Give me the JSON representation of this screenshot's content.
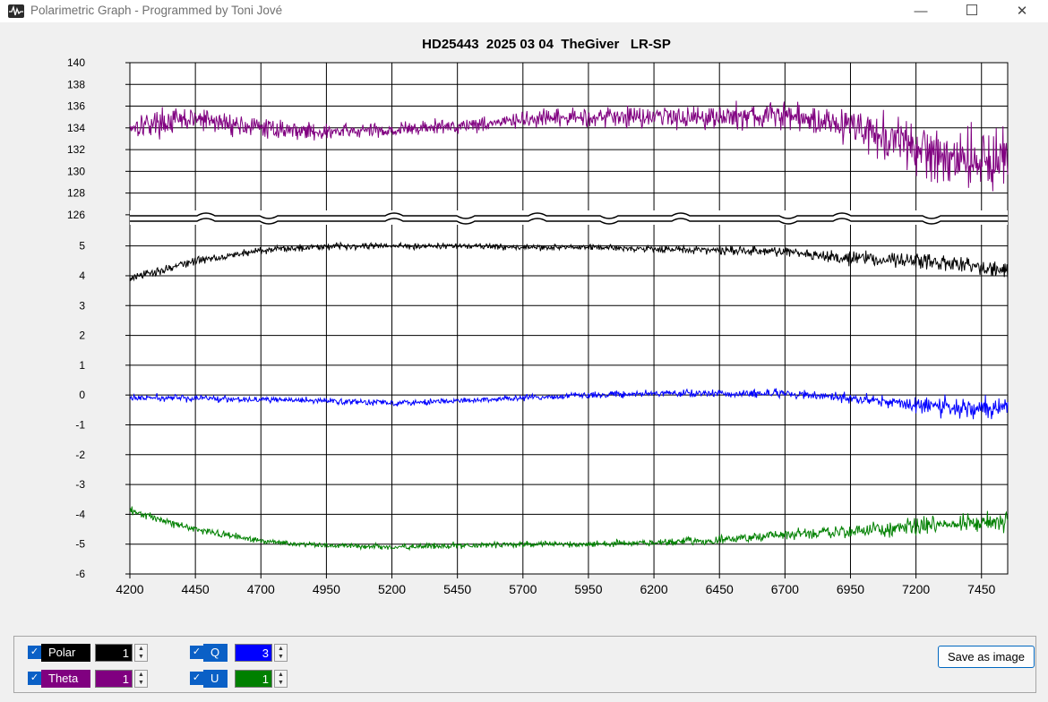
{
  "window": {
    "title": "Polarimetric Graph - Programmed by Toni Jové",
    "minimize_glyph": "—",
    "close_glyph": "✕"
  },
  "colors": {
    "polar": "#000000",
    "theta": "#800080",
    "q": "#0000ff",
    "u": "#008000"
  },
  "chart_data": {
    "type": "line",
    "title": "HD25443  2025 03 04  TheGiver   LR-SP",
    "xlim": [
      4200,
      7550
    ],
    "x_ticks": [
      "4200",
      "4450",
      "4700",
      "4950",
      "5200",
      "5450",
      "5700",
      "5950",
      "6200",
      "6450",
      "6700",
      "6950",
      "7200",
      "7450"
    ],
    "upper_panel": {
      "ylim": [
        125,
        140
      ],
      "y_ticks": [
        {
          "v": 140,
          "label": "140"
        },
        {
          "v": 138,
          "label": "138"
        },
        {
          "v": 136,
          "label": "136"
        },
        {
          "v": 134,
          "label": "134"
        },
        {
          "v": 132,
          "label": "132"
        },
        {
          "v": 130,
          "label": "130"
        },
        {
          "v": 128,
          "label": "128"
        },
        {
          "v": 126,
          "label": "126"
        }
      ]
    },
    "lower_panel": {
      "ylim": [
        -6,
        5.5
      ],
      "y_ticks": [
        {
          "v": 5,
          "label": "5"
        },
        {
          "v": 4,
          "label": "4"
        },
        {
          "v": 3,
          "label": "3"
        },
        {
          "v": 2,
          "label": "2"
        },
        {
          "v": 1,
          "label": "1"
        },
        {
          "v": 0,
          "label": "0"
        },
        {
          "v": -1,
          "label": "-1"
        },
        {
          "v": -2,
          "label": "-2"
        },
        {
          "v": -3,
          "label": "-3"
        },
        {
          "v": -4,
          "label": "-4"
        },
        {
          "v": -5,
          "label": "-5"
        },
        {
          "v": -6,
          "label": "-6"
        }
      ]
    },
    "series": [
      {
        "name": "Theta",
        "panel": "upper",
        "color": "#800080",
        "x": [
          4200,
          4450,
          4700,
          4950,
          5200,
          5450,
          5700,
          5950,
          6200,
          6450,
          6700,
          6950,
          7200,
          7450,
          7550
        ],
        "y": [
          134.2,
          134.8,
          134.0,
          133.6,
          133.8,
          134.2,
          134.7,
          135.0,
          135.1,
          135.0,
          135.1,
          134.3,
          132.0,
          131.0,
          131.5
        ],
        "noise": [
          0.8,
          0.8,
          0.6,
          0.5,
          0.5,
          0.5,
          0.5,
          0.6,
          0.7,
          0.8,
          0.9,
          1.1,
          1.8,
          2.0,
          2.0
        ]
      },
      {
        "name": "Polar",
        "panel": "lower",
        "color": "#000000",
        "x": [
          4200,
          4450,
          4700,
          4950,
          5200,
          5450,
          5700,
          5950,
          6200,
          6450,
          6700,
          6950,
          7200,
          7450,
          7550
        ],
        "y": [
          3.9,
          4.5,
          4.85,
          5.0,
          5.0,
          5.0,
          4.95,
          4.95,
          4.9,
          4.85,
          4.8,
          4.6,
          4.5,
          4.3,
          4.2
        ],
        "noise": [
          0.1,
          0.1,
          0.08,
          0.08,
          0.07,
          0.07,
          0.07,
          0.07,
          0.08,
          0.1,
          0.12,
          0.15,
          0.18,
          0.2,
          0.2
        ]
      },
      {
        "name": "Q",
        "panel": "lower",
        "color": "#0000ff",
        "x": [
          4200,
          4450,
          4700,
          4950,
          5200,
          5450,
          5700,
          5950,
          6200,
          6450,
          6700,
          6950,
          7200,
          7450,
          7550
        ],
        "y": [
          -0.1,
          -0.1,
          -0.15,
          -0.2,
          -0.25,
          -0.2,
          -0.1,
          0.0,
          0.05,
          0.05,
          0.05,
          -0.1,
          -0.35,
          -0.45,
          -0.4
        ],
        "noise": [
          0.08,
          0.08,
          0.07,
          0.07,
          0.07,
          0.07,
          0.07,
          0.08,
          0.08,
          0.09,
          0.1,
          0.12,
          0.2,
          0.25,
          0.25
        ]
      },
      {
        "name": "U",
        "panel": "lower",
        "color": "#008000",
        "x": [
          4200,
          4450,
          4700,
          4950,
          5200,
          5450,
          5700,
          5950,
          6200,
          6450,
          6700,
          6950,
          7200,
          7450,
          7550
        ],
        "y": [
          -3.9,
          -4.5,
          -4.9,
          -5.05,
          -5.1,
          -5.05,
          -5.0,
          -5.0,
          -4.95,
          -4.85,
          -4.7,
          -4.55,
          -4.4,
          -4.3,
          -4.2
        ],
        "noise": [
          0.1,
          0.08,
          0.07,
          0.07,
          0.07,
          0.07,
          0.07,
          0.07,
          0.08,
          0.1,
          0.12,
          0.15,
          0.2,
          0.22,
          0.22
        ]
      }
    ]
  },
  "controls": {
    "polar": {
      "label": "Polar",
      "checked": true,
      "value": "1"
    },
    "theta": {
      "label": "Theta",
      "checked": true,
      "value": "1"
    },
    "q": {
      "label": "Q",
      "checked": true,
      "value": "3"
    },
    "u": {
      "label": "U",
      "checked": true,
      "value": "1"
    },
    "check_glyph": "✓",
    "spin_up": "▲",
    "spin_down": "▼",
    "save_label": "Save as image"
  }
}
